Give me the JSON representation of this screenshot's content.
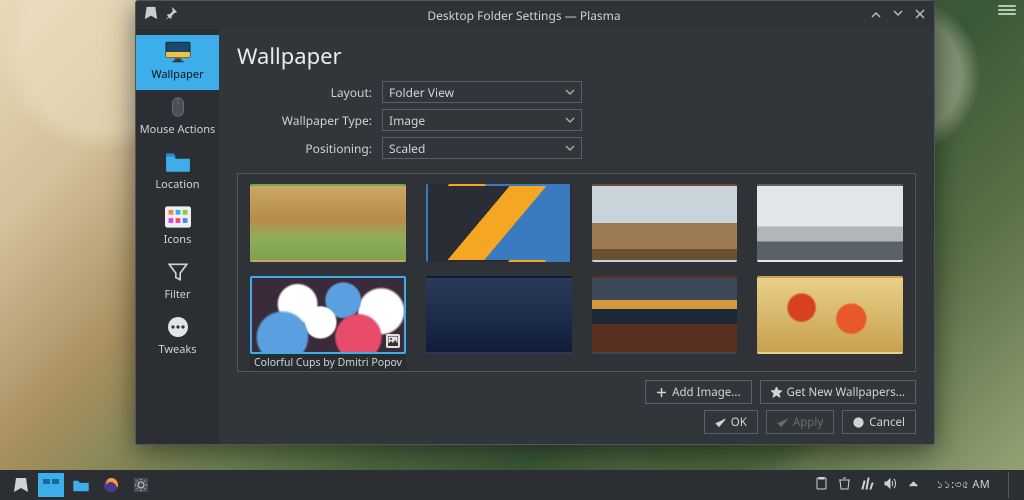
{
  "window": {
    "title": "Desktop Folder Settings — Plasma"
  },
  "sidebar": {
    "items": [
      {
        "label": "Wallpaper"
      },
      {
        "label": "Mouse Actions"
      },
      {
        "label": "Location"
      },
      {
        "label": "Icons"
      },
      {
        "label": "Filter"
      },
      {
        "label": "Tweaks"
      }
    ]
  },
  "page": {
    "heading": "Wallpaper",
    "layout_label": "Layout:",
    "layout_value": "Folder View",
    "type_label": "Wallpaper Type:",
    "type_value": "Image",
    "position_label": "Positioning:",
    "position_value": "Scaled"
  },
  "wallpapers": {
    "selected_caption": "Colorful Cups by Dmitri Popov"
  },
  "buttons": {
    "add_image": "Add Image...",
    "get_new": "Get New Wallpapers...",
    "ok": "OK",
    "apply": "Apply",
    "cancel": "Cancel"
  },
  "taskbar": {
    "clock": "১১:৩৫ AM"
  }
}
